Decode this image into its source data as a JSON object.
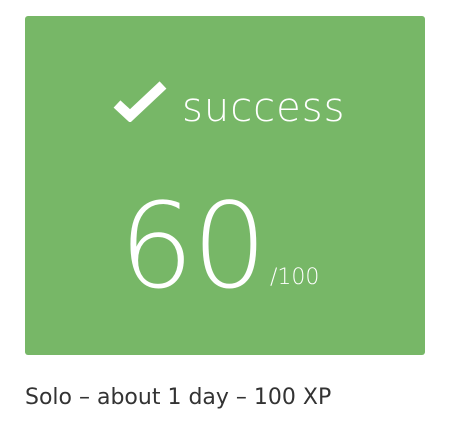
{
  "card": {
    "background_color": "#77b767",
    "status_icon": "check-icon",
    "status_label": "success",
    "score": "60",
    "score_max": "/100"
  },
  "meta": {
    "text": "Solo – about 1 day – 100 XP"
  }
}
